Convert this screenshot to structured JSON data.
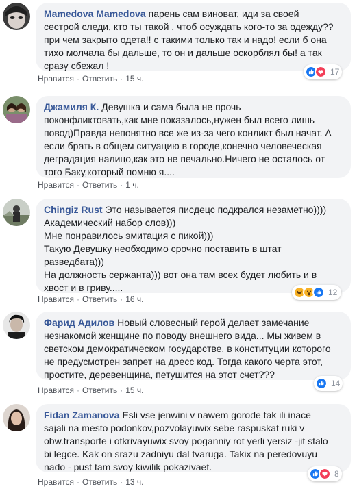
{
  "actions": {
    "like": "Нравится",
    "reply": "Ответить",
    "separator": "·"
  },
  "comments": [
    {
      "author": "Mamedova Mamedova",
      "lines": [
        "парень сам виноват, иди за своей",
        "сестрой следи, кто ты такой , чтоб осуждать кого-то за одежду??",
        "при чем закрыто одета!! с такими только так и надо! если б она",
        "тихо молчала бы дальше, то он и дальше оскорблял бы! а так",
        "сразу сбежал !"
      ],
      "time": "15 ч.",
      "reactions": {
        "icons": [
          "like-icon",
          "love-icon"
        ],
        "count": "17"
      }
    },
    {
      "author": "Джамиля К.",
      "lines": [
        "Девушка и сама была не прочь",
        "поконфликтовать,как мне показалось,нужен был всего лишь",
        "повод)Правда непонятно все же из-за чего конликт был начат. А",
        "если брать в общем ситуацию в городе,конечно человеческая",
        "деградация налицо,как это не печально.Ничего не осталось от",
        "того Баку,который помню я...."
      ],
      "time": "1 ч."
    },
    {
      "author": "Chingiz Rust",
      "lines": [
        "Это называется писдецс подкрался незаметно))))",
        "Академический набор слов)))",
        "Мне понравилось эмитация с пикой)))",
        "Такую Девушку необходимо срочно поставить в штат",
        "разведбата)))",
        "На должность сержанта))) вот она там всех будет любить и в",
        "хвост и в гриву....."
      ],
      "time": "16 ч.",
      "reactions": {
        "icons": [
          "haha-icon",
          "wow-icon",
          "like-icon"
        ],
        "count": "12"
      }
    },
    {
      "author": "Фарид Адилов",
      "lines": [
        "Новый словесный герой делает замечание",
        "незнакомой женщине по поводу внешнего вида... Мы живем в",
        "светском демократическом государстве, в конституции которого",
        "не предусмотрен запрет на дресс код. Тогда какого черта этот,",
        "простите, деревенщина, петушится на этот счет???"
      ],
      "time": "15 ч.",
      "reactions": {
        "icons": [
          "like-icon"
        ],
        "count": "14"
      }
    },
    {
      "author": "Fidan Zamanova",
      "lines": [
        "Esli vse jenwini v nawem gorode tak ili inace",
        "sajali na mesto podonkov,pozvolayuwix sebe raspuskat ruki v",
        "obw.transporte i otkrivayuwix svoy poganniy rot yerli yersiz -jit stalo",
        "bi legce. Kak on srazu zadniyu dal tvaruga. Takix na peredovuyu",
        "nado - pust tam svoy kiwilik pokazivaet."
      ],
      "time": "13 ч.",
      "reactions": {
        "icons": [
          "like-icon",
          "love-icon"
        ],
        "count": "8"
      }
    }
  ],
  "colors": {
    "author": "#385898",
    "bubble": "#f2f3f5",
    "like": "#1877f2",
    "love": "#f33e58",
    "haha": "#f7b125"
  }
}
